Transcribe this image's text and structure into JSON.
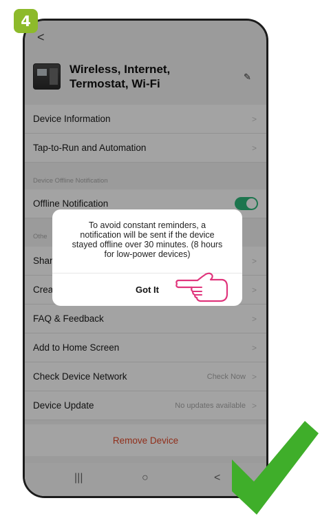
{
  "step_badge": "4",
  "top_bar": {
    "back_glyph": "<"
  },
  "device": {
    "name": "Wireless, Internet, Termostat, Wi-Fi"
  },
  "menu": {
    "device_information": "Device Information",
    "tap_to_run": "Tap-to-Run and Automation",
    "offline_section_label": "Device Offline Notification",
    "offline_notification": "Offline Notification",
    "offline_notification_enabled": true,
    "others_section_label_partial": "Othe",
    "share_partial": "Shar",
    "create_partial": "Crea",
    "faq": "FAQ & Feedback",
    "add_home": "Add to Home Screen",
    "check_network": "Check Device Network",
    "check_network_value": "Check Now",
    "device_update": "Device Update",
    "device_update_value": "No updates available",
    "remove_device": "Remove Device"
  },
  "dialog": {
    "line1": "To avoid constant reminders, a",
    "line2": "notification will be sent if the device",
    "line3": "stayed offline over 30 minutes. (8 hours",
    "line4": "for low-power devices)",
    "button": "Got It"
  },
  "navbar": {
    "recent_glyph": "|||",
    "home_glyph": "○",
    "back_glyph": "<"
  },
  "colors": {
    "badge": "#8dba2b",
    "toggle_on": "#2eb87a",
    "remove": "#e24a2b",
    "hand_outline": "#e0357c",
    "checkmark": "#3fae2a"
  },
  "icons": [
    "pointing-hand-icon",
    "checkmark-icon",
    "edit-icon",
    "chevron-right-icon"
  ]
}
